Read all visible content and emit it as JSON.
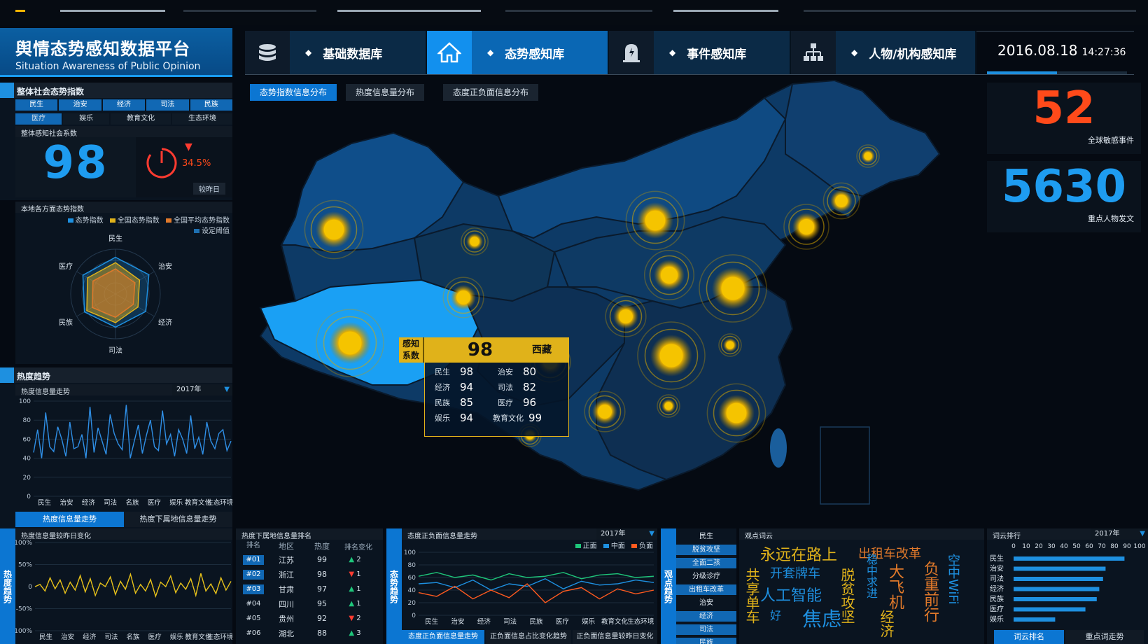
{
  "app": {
    "title": "舆情态势感知数据平台",
    "subtitle": "Situation Awareness of Public Opinion"
  },
  "nav": {
    "items": [
      {
        "label": "基础数据库",
        "icon": "database-icon",
        "active": false
      },
      {
        "label": "态势感知库",
        "icon": "home-icon",
        "active": true
      },
      {
        "label": "事件感知库",
        "icon": "alert-icon",
        "active": false
      },
      {
        "label": "人物/机构感知库",
        "icon": "org-chart-icon",
        "active": false
      }
    ]
  },
  "datetime": {
    "date": "2016.08.18",
    "time": "14:27:36"
  },
  "overall": {
    "title": "整体社会态势指数",
    "categories_row1": [
      "民生",
      "治安",
      "经济",
      "司法",
      "民族"
    ],
    "categories_row2": [
      "医疗",
      "娱乐",
      "教育文化",
      "生态环境"
    ],
    "coef_label": "整体感知社会系数",
    "coef_value": "98",
    "change": "34.5%",
    "change_label": "较昨日"
  },
  "local": {
    "title": "本地各方面态势指数",
    "legend": [
      "态势指数",
      "全国态势指数",
      "全国平均态势指数",
      "设定阈值"
    ],
    "legend_colors": [
      "#1e90e0",
      "#e0b21a",
      "#e0792a",
      "#1e6fb0"
    ],
    "radar_axes": [
      "民生",
      "治安",
      "经济",
      "司法",
      "民族",
      "医疗"
    ]
  },
  "heat": {
    "title": "热度趋势",
    "chart_title": "热度信息量走势",
    "year": "2017年",
    "tabs": [
      "热度信息量走势",
      "热度下属地信息量走势"
    ]
  },
  "tabs": [
    "态势指数信息分布",
    "热度信息量分布",
    "态度正负面信息分布"
  ],
  "stats": [
    {
      "value": "52",
      "label": "全球敏感事件",
      "color": "#ff4a1a"
    },
    {
      "value": "5630",
      "label": "重点人物发文",
      "color": "#1e9cf0"
    }
  ],
  "popup": {
    "tag": "感知系数",
    "value": "98",
    "region": "西藏",
    "rows": [
      [
        {
          "k": "民生",
          "v": "98"
        },
        {
          "k": "治安",
          "v": "80"
        }
      ],
      [
        {
          "k": "经济",
          "v": "94"
        },
        {
          "k": "司法",
          "v": "82"
        }
      ],
      [
        {
          "k": "民族",
          "v": "85"
        },
        {
          "k": "医疗",
          "v": "96"
        }
      ],
      [
        {
          "k": "娱乐",
          "v": "94"
        },
        {
          "k": "教育文化",
          "v": "99"
        }
      ]
    ]
  },
  "bottom": {
    "heat_compare_title": "热度信息量较昨日变化",
    "heat_vlabel": "热度趋势",
    "rank_title": "热度下属地信息量排名",
    "rank_headers": [
      "排名",
      "地区",
      "热度",
      "排名变化"
    ],
    "rank_rows": [
      {
        "no": "#01",
        "area": "江苏",
        "heat": "99",
        "dir": "up",
        "chg": "2"
      },
      {
        "no": "#02",
        "area": "浙江",
        "heat": "98",
        "dir": "down",
        "chg": "1"
      },
      {
        "no": "#03",
        "area": "甘肃",
        "heat": "97",
        "dir": "up",
        "chg": "1"
      },
      {
        "no": "#04",
        "area": "四川",
        "heat": "95",
        "dir": "up",
        "chg": "1"
      },
      {
        "no": "#05",
        "area": "贵州",
        "heat": "92",
        "dir": "down",
        "chg": "2"
      },
      {
        "no": "#06",
        "area": "湖北",
        "heat": "88",
        "dir": "up",
        "chg": "3"
      }
    ],
    "attitude_vlabel": "态势趋势",
    "attitude_title": "态度正负面信息量走势",
    "attitude_year": "2017年",
    "attitude_legend": [
      "正面",
      "中面",
      "负面"
    ],
    "attitude_colors": [
      "#1ec67a",
      "#1e90e0",
      "#ff5a1f"
    ],
    "attitude_tabs": [
      "态度正负面信息量走势",
      "正负面信息占比变化趋势",
      "正负面信息量较昨日变化"
    ],
    "view_vlabel": "观点趋势",
    "keywords": [
      "民生",
      "脱贫攻坚",
      "全面二孩",
      "分级诊疗",
      "出租车改革",
      "治安",
      "经济",
      "司法",
      "民族"
    ],
    "keyword_active": [
      1,
      2,
      4,
      6,
      7,
      8
    ],
    "words_title": "观点词云",
    "cloud_words": [
      "永远在路上",
      "出租车改革",
      "开套牌车",
      "人工智能",
      "焦虑",
      "共享单车",
      "脱贫攻坚",
      "大飞机",
      "负重前行",
      "空中WiFi",
      "稳中求进",
      "经济",
      "好"
    ],
    "word_rank_title": "词云排行",
    "word_rank_year": "2017年",
    "word_rank_tabs": [
      "词云排名",
      "重点词走势"
    ]
  },
  "chart_data": [
    {
      "type": "radar",
      "title": "本地各方面态势指数",
      "axes": [
        "民生",
        "治安",
        "经济",
        "司法",
        "民族",
        "医疗"
      ],
      "series": [
        {
          "name": "态势指数",
          "values": [
            82,
            86,
            78,
            74,
            80,
            84
          ]
        },
        {
          "name": "全国态势指数",
          "values": [
            70,
            62,
            58,
            64,
            74,
            72
          ]
        },
        {
          "name": "全国平均态势指数",
          "values": [
            56,
            50,
            46,
            52,
            60,
            58
          ]
        }
      ],
      "range": [
        0,
        100
      ]
    },
    {
      "type": "line",
      "title": "热度信息量走势",
      "categories": [
        "民生",
        "治安",
        "经济",
        "司法",
        "名族",
        "医疗",
        "娱乐",
        "教育文化",
        "生态环境"
      ],
      "ylim": [
        0,
        100
      ],
      "yticks": [
        0,
        20,
        40,
        60,
        80,
        100
      ],
      "series": [
        {
          "name": "",
          "values": [
            46,
            70,
            40,
            88,
            52,
            47,
            73,
            60,
            42,
            78,
            50,
            52,
            65,
            40,
            94,
            46,
            72,
            58,
            44,
            86,
            66,
            55,
            49,
            96,
            40,
            58,
            75,
            45,
            64,
            80,
            52,
            48,
            90,
            55,
            65,
            42,
            70,
            60,
            45,
            85,
            50,
            62,
            44,
            78,
            58,
            50,
            66,
            70,
            48,
            58
          ]
        }
      ]
    },
    {
      "type": "line",
      "title": "热度信息量较昨日变化",
      "categories": [
        "民生",
        "治安",
        "经济",
        "司法",
        "名族",
        "医疗",
        "娱乐",
        "教育文化",
        "生态环境"
      ],
      "ylim": [
        -100,
        100
      ],
      "yticks": [
        "100%",
        "50%",
        "0",
        "-50%",
        "-100%"
      ],
      "series": [
        {
          "name": "",
          "values": [
            0,
            5,
            -10,
            20,
            -5,
            15,
            -15,
            10,
            -8,
            25,
            -12,
            18,
            -20,
            8,
            0,
            22,
            -18,
            12,
            -6,
            28,
            -15,
            5,
            -10,
            16,
            -22,
            10,
            0,
            24,
            -14,
            8,
            -6,
            18,
            -20,
            30,
            -10,
            6,
            -16,
            20,
            -8,
            12
          ]
        }
      ]
    },
    {
      "type": "line",
      "title": "态度正负面信息量走势",
      "categories": [
        "民生",
        "治安",
        "经济",
        "司法",
        "民族",
        "医疗",
        "娱乐",
        "教育文化",
        "生态环境"
      ],
      "ylim": [
        0,
        100
      ],
      "yticks": [
        0,
        20,
        40,
        60,
        80,
        100
      ],
      "series": [
        {
          "name": "正面",
          "values": [
            62,
            68,
            60,
            64,
            56,
            66,
            60,
            62,
            68,
            58,
            64,
            66,
            60,
            62
          ]
        },
        {
          "name": "中面",
          "values": [
            50,
            52,
            44,
            56,
            40,
            50,
            46,
            58,
            42,
            54,
            48,
            50,
            56,
            52
          ]
        },
        {
          "name": "负面",
          "values": [
            36,
            30,
            46,
            26,
            40,
            28,
            50,
            20,
            38,
            44,
            26,
            42,
            34,
            40
          ]
        }
      ]
    },
    {
      "type": "bar",
      "title": "词云排行",
      "orientation": "horizontal",
      "categories": [
        "民生",
        "治安",
        "司法",
        "经济",
        "民族",
        "医疗",
        "娱乐"
      ],
      "values": [
        88,
        73,
        71,
        68,
        66,
        57,
        33
      ],
      "xlim": [
        0,
        100
      ],
      "xticks": [
        0,
        10,
        20,
        30,
        40,
        50,
        60,
        70,
        80,
        90,
        100
      ]
    }
  ]
}
